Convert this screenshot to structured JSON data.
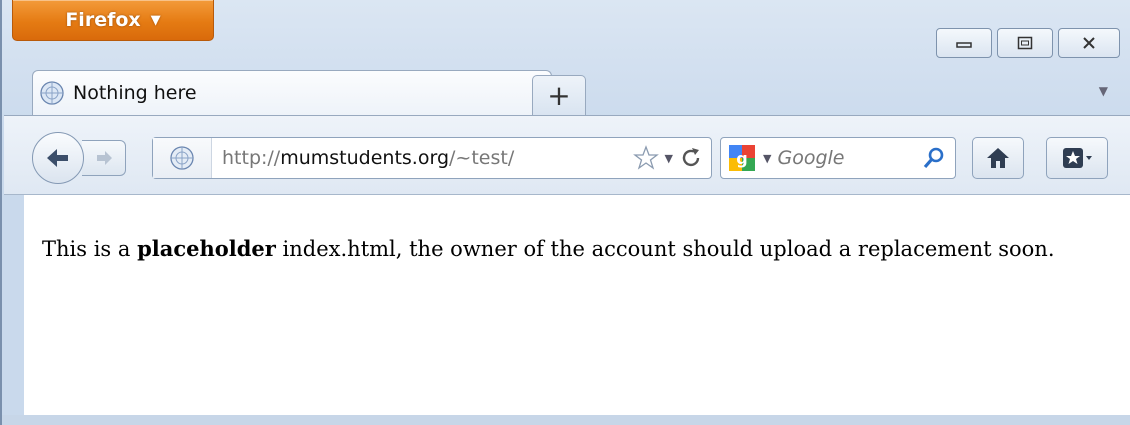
{
  "app_button": {
    "label": "Firefox"
  },
  "window_controls": [
    "minimize",
    "maximize",
    "close"
  ],
  "tabs": [
    {
      "title": "Nothing here",
      "active": true
    }
  ],
  "new_tab_label": "+",
  "urlbar": {
    "url_prefix": "http://",
    "url_host": "mumstudents.org",
    "url_path": "/~test/"
  },
  "search": {
    "placeholder": "Google"
  },
  "content": {
    "text_before": "This is a ",
    "text_bold": "placeholder",
    "text_after": " index.html, the owner of the account should upload a replacement soon."
  },
  "colors": {
    "app_button": "#e57b13",
    "chrome": "#c9d9ec"
  }
}
